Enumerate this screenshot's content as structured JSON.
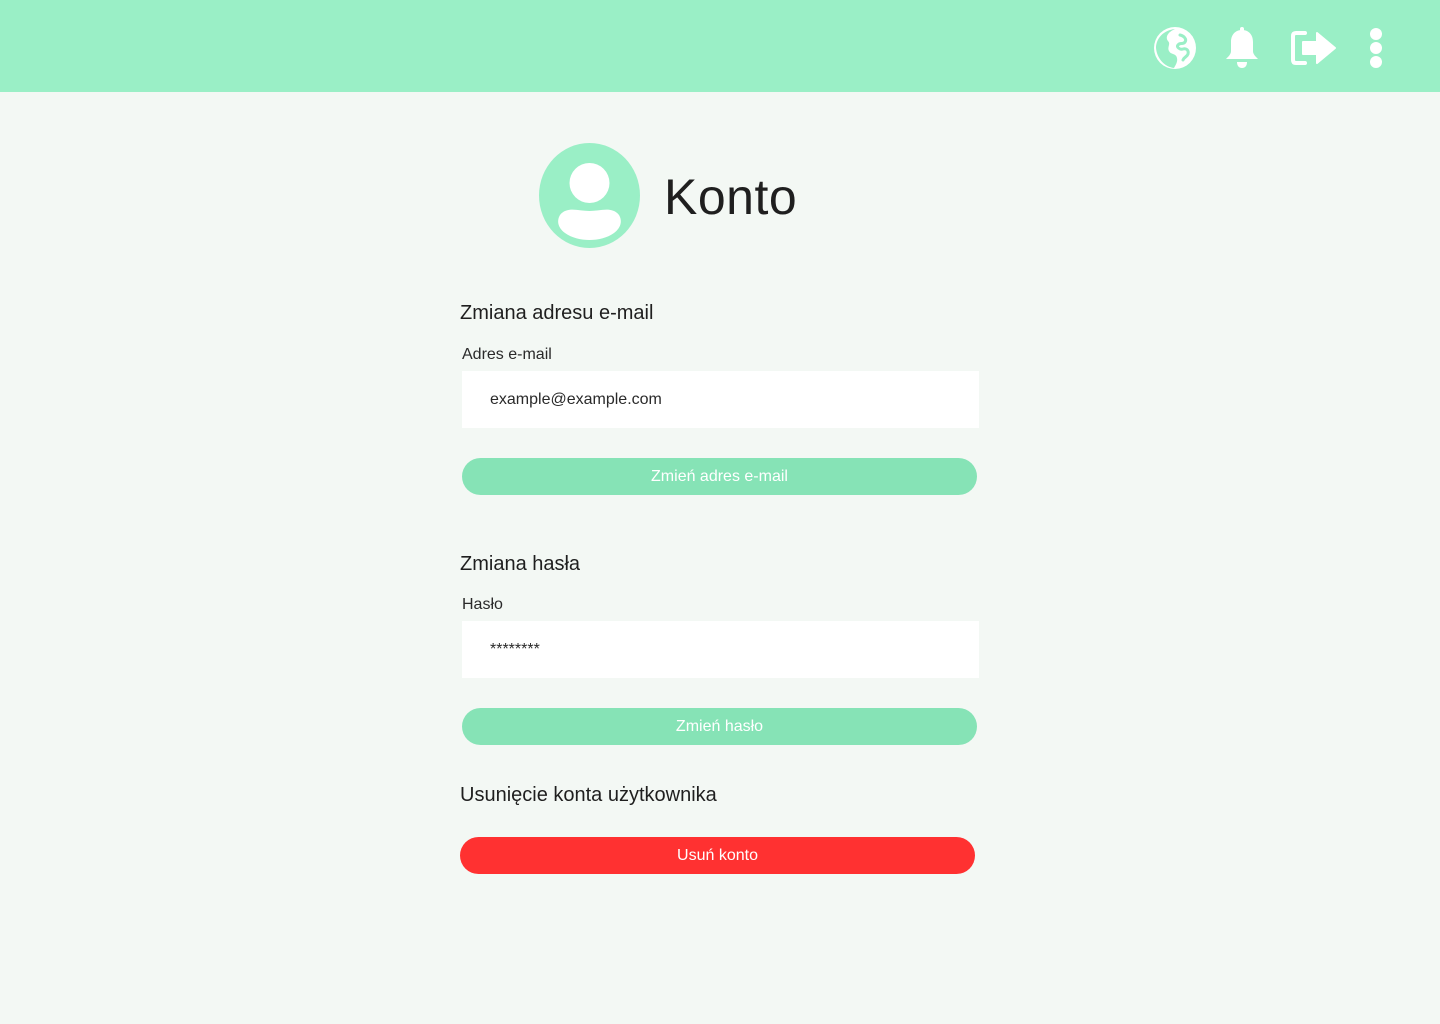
{
  "colors": {
    "topbar": "#9aefc6",
    "background": "#f3f8f4",
    "accent_green": "#86e3b6",
    "danger_red": "#ff3131",
    "avatar": "#9aefc6"
  },
  "topbar": {
    "icons": [
      "globe-icon",
      "bell-icon",
      "logout-icon",
      "more-vertical-icon"
    ]
  },
  "header": {
    "title": "Konto",
    "avatar_icon": "user-avatar-icon"
  },
  "email_section": {
    "title": "Zmiana adresu e-mail",
    "field_label": "Adres e-mail",
    "field_value": "example@example.com",
    "button_label": "Zmień adres e-mail"
  },
  "password_section": {
    "title": "Zmiana hasła",
    "field_label": "Hasło",
    "field_value": "********",
    "button_label": "Zmień hasło"
  },
  "delete_section": {
    "title": "Usunięcie konta użytkownika",
    "button_label": "Usuń konto"
  }
}
